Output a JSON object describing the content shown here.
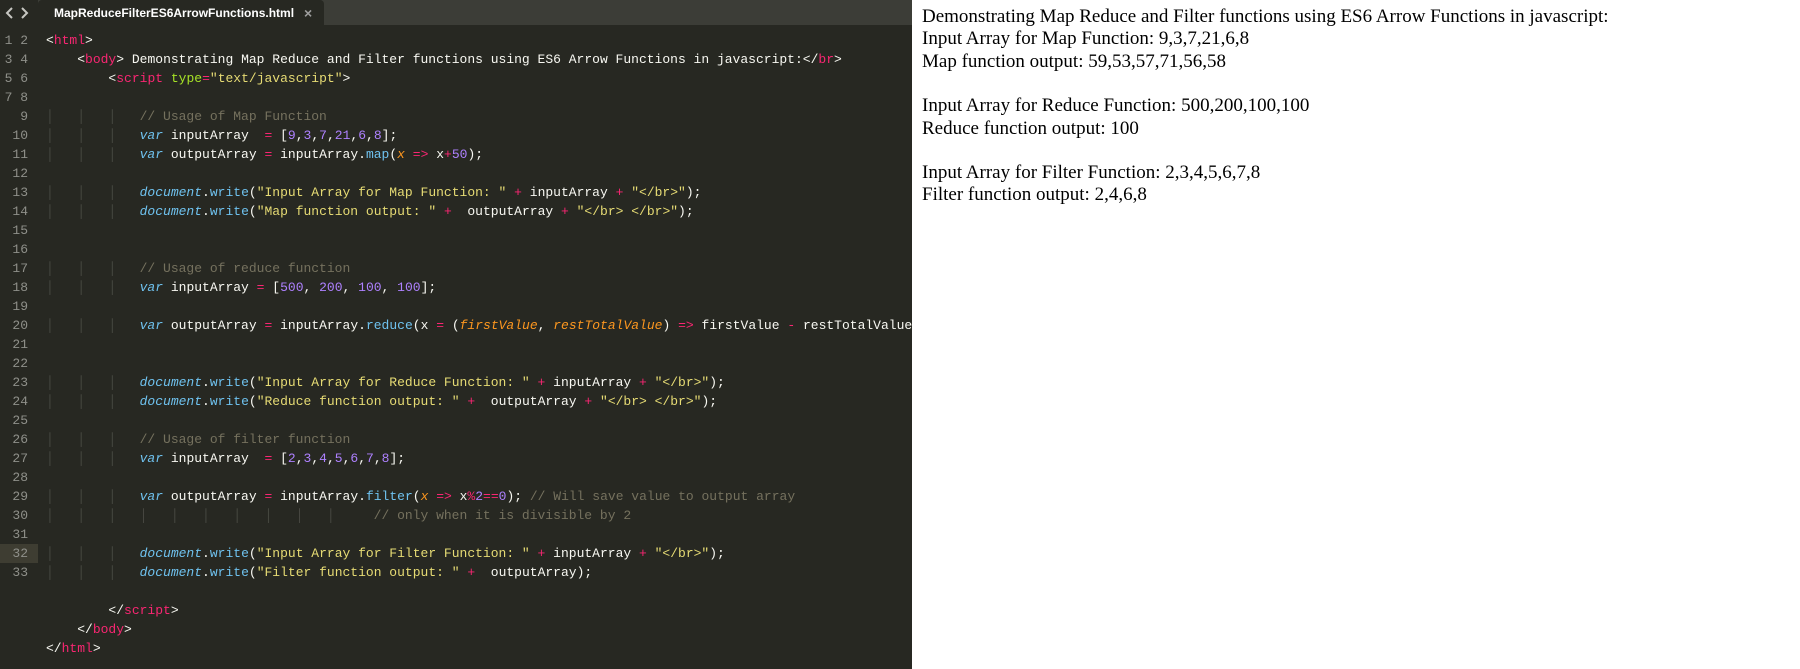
{
  "tab": {
    "title": "MapReduceFilterES6ArrowFunctions.html",
    "close": "×"
  },
  "gutter": {
    "start": 1,
    "end": 33,
    "highlight": 32
  },
  "code": {
    "l2_text": " Demonstrating Map Reduce and Filter functions using ES6 Arrow Functions in javascript:",
    "l3_type_attr": "type",
    "l3_type_val": "\"text/javascript\"",
    "c_map": "// Usage of Map Function",
    "l6_arr": {
      "vals": [
        "9",
        "3",
        "7",
        "21",
        "6",
        "8"
      ]
    },
    "l7_fn": "map",
    "l7_add": "50",
    "l9_s1": "\"Input Array for Map Function: \"",
    "l9_s2": "\"</br>\"",
    "l10_s1": "\"Map function output: \"",
    "l10_s2": "\"</br> </br>\"",
    "c_reduce": "// Usage of reduce function",
    "l14_arr": {
      "vals": [
        "500",
        "200",
        "100",
        "100"
      ]
    },
    "l16_fn": "reduce",
    "l16_p1": "firstValue",
    "l16_p2": "restTotalValue",
    "l19_s1": "\"Input Array for Reduce Function: \"",
    "l19_s2": "\"</br>\"",
    "l20_s1": "\"Reduce function output: \"",
    "l20_s2": "\"</br> </br>\"",
    "c_filter": "// Usage of filter function",
    "l23_arr": {
      "vals": [
        "2",
        "3",
        "4",
        "5",
        "6",
        "7",
        "8"
      ]
    },
    "l25_fn": "filter",
    "l25_mod": "2",
    "l25_eqeq": "0",
    "l25_cm1": "// Will save value to output array",
    "l26_cm2": "// only when it is divisible by 2",
    "l28_s1": "\"Input Array for Filter Function: \"",
    "l28_s2": "\"</br>\"",
    "l29_s1": "\"Filter function output: \"",
    "tag_html": "html",
    "tag_body": "body",
    "tag_script": "script",
    "tag_br": "br",
    "id_inputArray": "inputArray",
    "id_outputArray": "outputArray",
    "id_document": "document",
    "id_write": "write",
    "id_x": "x",
    "id_firstValue": "firstValue",
    "id_restTotalValue": "restTotalValue"
  },
  "output": {
    "l1": "Demonstrating Map Reduce and Filter functions using ES6 Arrow Functions in javascript:",
    "l2": "Input Array for Map Function: 9,3,7,21,6,8",
    "l3": "Map function output: 59,53,57,71,56,58",
    "l4": "Input Array for Reduce Function: 500,200,100,100",
    "l5": "Reduce function output: 100",
    "l6": "Input Array for Filter Function: 2,3,4,5,6,7,8",
    "l7": "Filter function output: 2,4,6,8"
  }
}
